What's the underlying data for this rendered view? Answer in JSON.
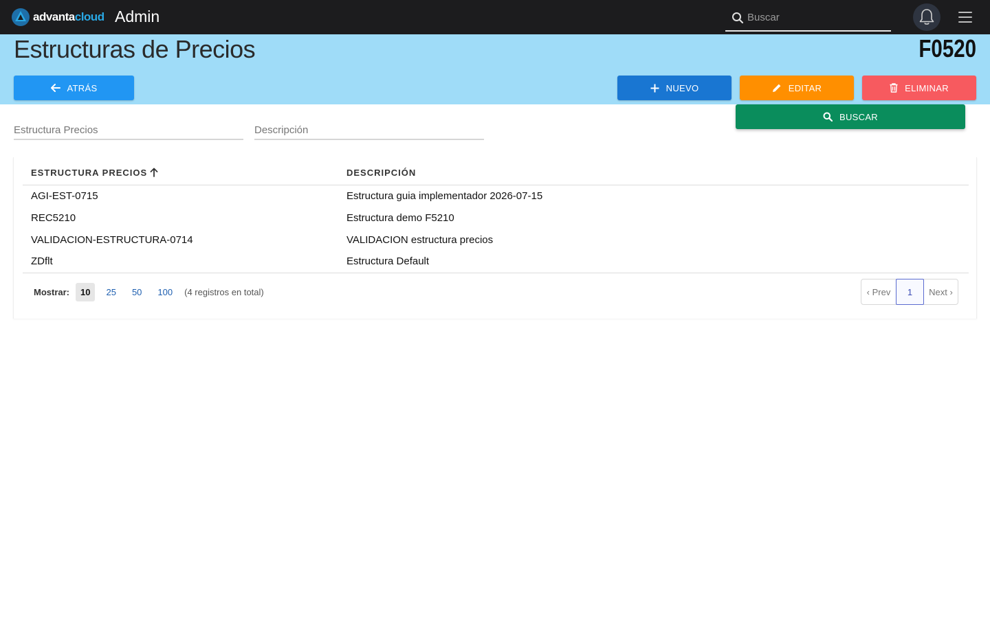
{
  "topbar": {
    "logo_part1": "advanta",
    "logo_part2": "cloud",
    "app_name": "Admin",
    "search_placeholder": "Buscar"
  },
  "header": {
    "title": "Estructuras de Precios",
    "form_code": "F0520"
  },
  "actions": {
    "back": "ATRÁS",
    "new": "NUEVO",
    "edit": "EDITAR",
    "delete": "ELIMINAR",
    "search": "BUSCAR"
  },
  "filters": {
    "estructura_placeholder": "Estructura Precios",
    "descripcion_placeholder": "Descripción"
  },
  "table": {
    "columns": [
      "ESTRUCTURA PRECIOS",
      "DESCRIPCIÓN"
    ],
    "rows": [
      [
        "AGI-EST-0715",
        "Estructura guia implementador 2026-07-15"
      ],
      [
        "REC5210",
        "Estructura demo F5210"
      ],
      [
        "VALIDACION-ESTRUCTURA-0714",
        "VALIDACION estructura precios"
      ],
      [
        "ZDflt",
        "Estructura Default"
      ]
    ]
  },
  "pager": {
    "show_label": "Mostrar:",
    "page_sizes": [
      "10",
      "25",
      "50",
      "100"
    ],
    "active_size": "10",
    "total": "(4 registros en total)",
    "prev": "‹ Prev",
    "current": "1",
    "next": "Next ›"
  },
  "colors": {
    "topbar": "#1c1c1e",
    "header_band": "#9fdcf8",
    "back": "#2196f3",
    "new": "#1976d2",
    "edit": "#ff8f00",
    "delete": "#f75a5f",
    "search": "#0a8d5c"
  }
}
